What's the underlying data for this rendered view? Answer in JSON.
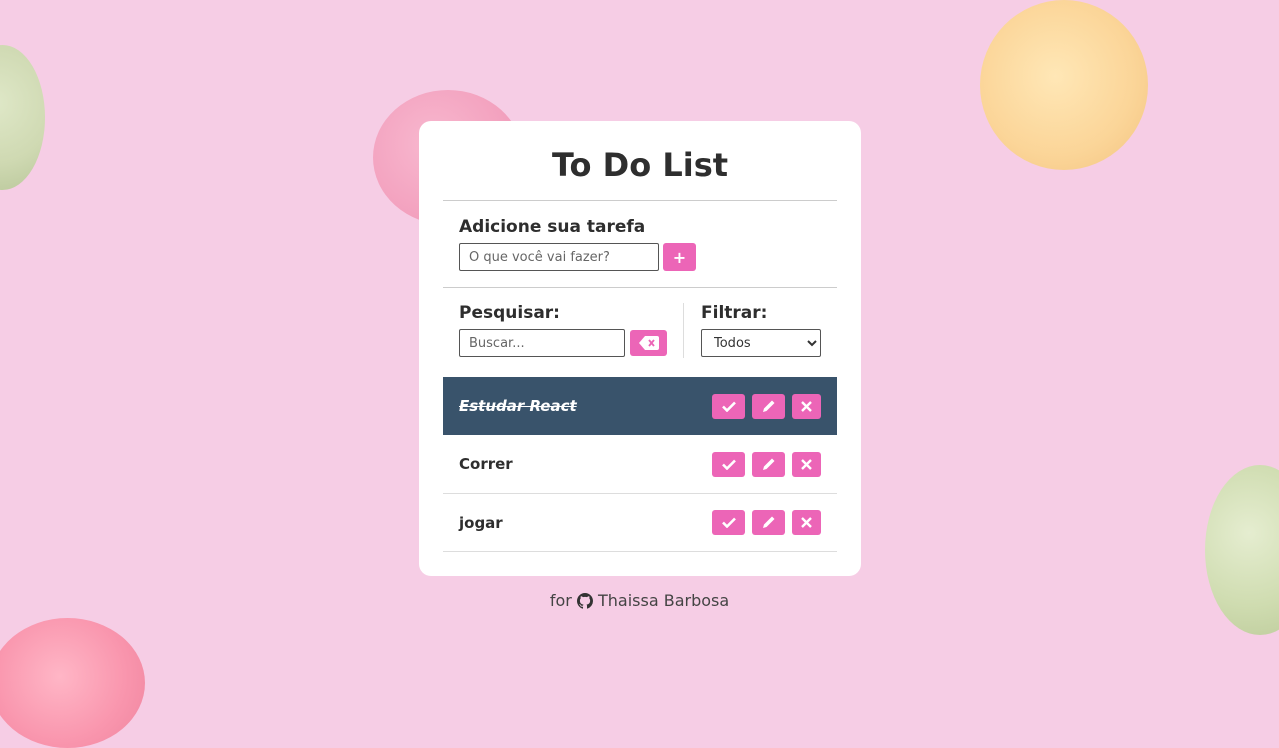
{
  "app": {
    "title": "To Do List"
  },
  "add": {
    "label": "Adicione sua tarefa",
    "placeholder": "O que você vai fazer?",
    "button_label": "+"
  },
  "search": {
    "label": "Pesquisar:",
    "placeholder": "Buscar..."
  },
  "filter": {
    "label": "Filtrar:",
    "selected": "Todos"
  },
  "todos": [
    {
      "text": "Estudar React",
      "done": true
    },
    {
      "text": "Correr",
      "done": false
    },
    {
      "text": "jogar",
      "done": false
    }
  ],
  "footer": {
    "prefix": "for",
    "author": "Thaissa Barbosa",
    "icon": "github-icon"
  },
  "colors": {
    "accent": "#ec65b7",
    "done_row": "#39536b",
    "background": "#f6cde5"
  }
}
